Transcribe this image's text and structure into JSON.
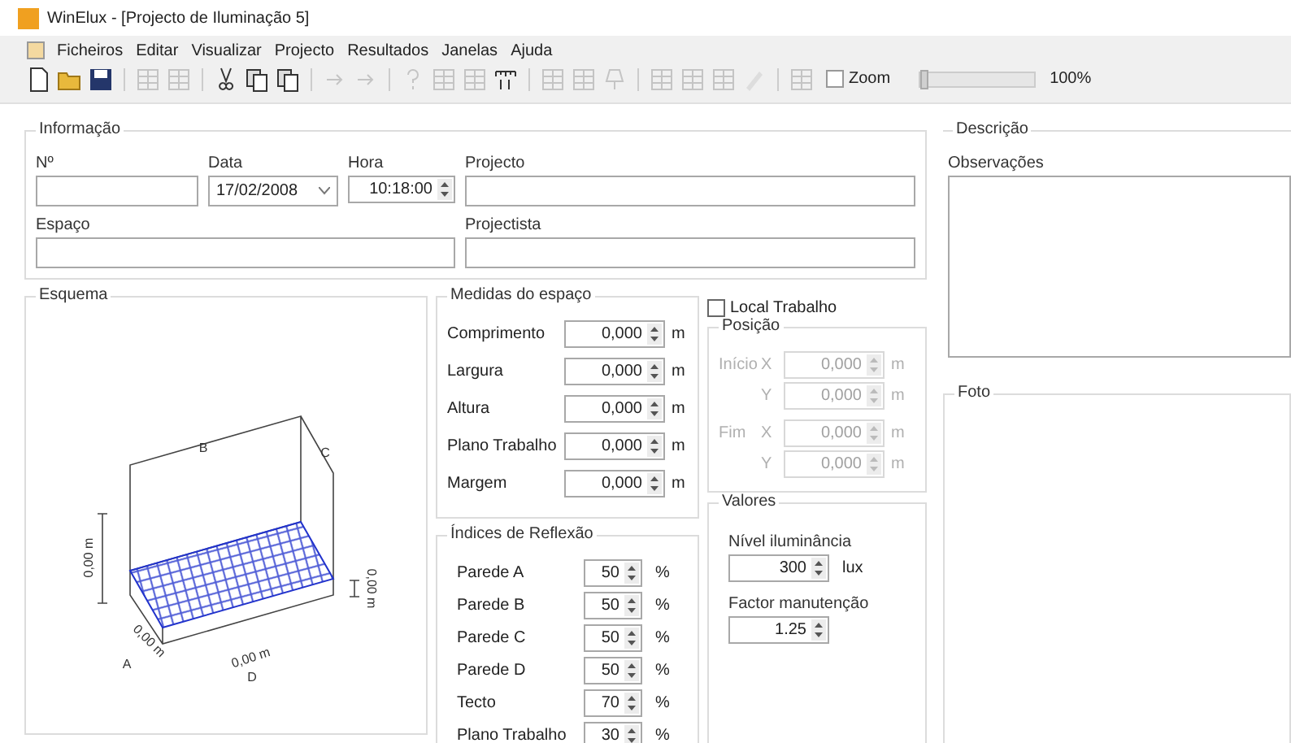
{
  "window": {
    "title": "WinElux - [Projecto de Iluminação 5]"
  },
  "menu": [
    "Ficheiros",
    "Editar",
    "Visualizar",
    "Projecto",
    "Resultados",
    "Janelas",
    "Ajuda"
  ],
  "toolbar": {
    "zoom": {
      "label": "Zoom",
      "checked": false,
      "level": 0
    },
    "zoom_reading": "100%"
  },
  "informacao": {
    "title": "Informação",
    "fields": [
      {
        "label": "Nº",
        "kind": "text"
      },
      {
        "label": "Data",
        "value": "17/02/2008",
        "kind": "date"
      },
      {
        "label": "Hora",
        "value": "10:18:00",
        "kind": "spin"
      },
      {
        "label": "Projecto",
        "kind": "text"
      },
      {
        "label": "Espaço",
        "kind": "text"
      },
      {
        "label": "Projectista",
        "kind": "text"
      }
    ]
  },
  "descricao": {
    "title": "Descrição",
    "observacoes_label": "Observações"
  },
  "esquema": {
    "title": "Esquema",
    "labels": {
      "wall_b": "B",
      "wall_c": "C",
      "wall_a": "A",
      "wall_d": "D",
      "height": "0,00 m",
      "plane": "0,00 m",
      "width": "0,00 m",
      "length": "0,00 m"
    }
  },
  "medidas": {
    "title": "Medidas do espaço",
    "rows": [
      {
        "label": "Comprimento",
        "value": "0,000",
        "unit": "m"
      },
      {
        "label": "Largura",
        "value": "0,000",
        "unit": "m"
      },
      {
        "label": "Altura",
        "value": "0,000",
        "unit": "m"
      },
      {
        "label": "Plano Trabalho",
        "value": "0,000",
        "unit": "m"
      },
      {
        "label": "Margem",
        "value": "0,000",
        "unit": "m"
      }
    ]
  },
  "local_trabalho": {
    "label": "Local Trabalho",
    "checked": false
  },
  "posicao": {
    "title": "Posição",
    "disabled": true,
    "rows": [
      {
        "label": "Início",
        "axis": "X",
        "value": "0,000",
        "unit": "m"
      },
      {
        "axis": "Y",
        "value": "0,000",
        "unit": "m"
      },
      {
        "label": "Fim",
        "axis": "X",
        "value": "0,000",
        "unit": "m"
      },
      {
        "axis": "Y",
        "value": "0,000",
        "unit": "m"
      }
    ]
  },
  "indices": {
    "title": "Índices de Reflexão",
    "rows": [
      {
        "label": "Parede A",
        "value": "50",
        "unit": "%"
      },
      {
        "label": "Parede B",
        "value": "50",
        "unit": "%"
      },
      {
        "label": "Parede C",
        "value": "50",
        "unit": "%"
      },
      {
        "label": "Parede D",
        "value": "50",
        "unit": "%"
      },
      {
        "label": "Tecto",
        "value": "70",
        "unit": "%"
      },
      {
        "label": "Plano Trabalho",
        "value": "30",
        "unit": "%"
      }
    ]
  },
  "valores": {
    "title": "Valores",
    "rows": [
      {
        "label": "Nível iluminância",
        "value": "300",
        "unit": "lux"
      },
      {
        "label": "Factor manutenção",
        "value": "1.25"
      }
    ]
  },
  "foto": {
    "title": "Foto"
  }
}
